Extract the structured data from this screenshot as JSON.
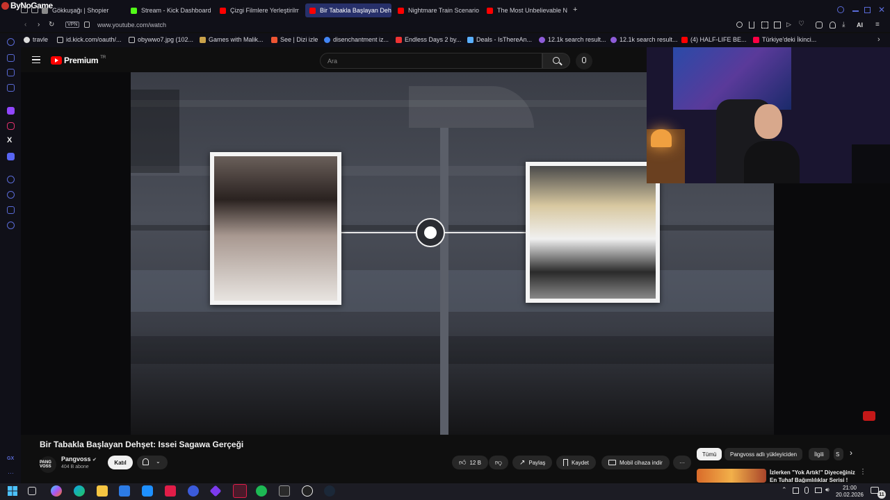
{
  "browser": {
    "brand": "ByNoGame",
    "tabs": [
      {
        "label": "Gökkuşağı | Shopier",
        "color": "#8a8a8a"
      },
      {
        "label": "Stream - Kick Dashboard",
        "color": "#53fc18"
      },
      {
        "label": "Çizgi Filmlere Yerleştirilmiş",
        "color": "#ff0000"
      },
      {
        "label": "Bir Tabakla Başlayan Dehşe",
        "color": "#ff0000",
        "active": true
      },
      {
        "label": "Nightmare Train Scenario",
        "color": "#ff0000"
      },
      {
        "label": "The Most Unbelievable Na",
        "color": "#ff0000"
      }
    ],
    "new_tab": "+",
    "vpn": "VPN",
    "url": "www.youtube.com/watch",
    "bookmarks": [
      {
        "label": "travle"
      },
      {
        "label": "id.kick.com/oauth/..."
      },
      {
        "label": "obywwo7.jpg (102..."
      },
      {
        "label": "Games with Malik..."
      },
      {
        "label": "See | Dizi izle"
      },
      {
        "label": "disenchantment iz..."
      },
      {
        "label": "Endless Days 2 by..."
      },
      {
        "label": "Deals - IsThereAn..."
      },
      {
        "label": "12.1k search result..."
      },
      {
        "label": "12.1k search result..."
      },
      {
        "label": "(4) HALF-LIFE BE..."
      },
      {
        "label": "Türkiye'deki İkinci..."
      }
    ],
    "ai_label": "AI"
  },
  "youtube": {
    "logo": "Premium",
    "region": "TR",
    "search_placeholder": "Ara",
    "video_title": "Bir Tabakla Başlayan Dehşet: Issei Sagawa Gerçeği",
    "channel": {
      "name": "Pangvoss",
      "subscribers": "404 B abone",
      "avatar_text": "PANG VOSS"
    },
    "join_label": "Katıl",
    "like_count": "12 B",
    "share_label": "Paylaş",
    "save_label": "Kaydet",
    "download_label": "Mobil cihaza indir",
    "chips": [
      "Tümü",
      "Pangvoss adlı yükleyiciden",
      "İlgili",
      "S"
    ],
    "recommendation_title": "İzlerken \"Yok Artık!\" Diyeceğiniz En Tuhaf Bağımlılıklar Serisi !"
  },
  "taskbar": {
    "time": "21:00",
    "date": "20.02.2026",
    "notification_count": "11"
  },
  "colors": {
    "accent": "#27306a",
    "youtube_red": "#ff0000",
    "background": "#0f0f0f"
  }
}
